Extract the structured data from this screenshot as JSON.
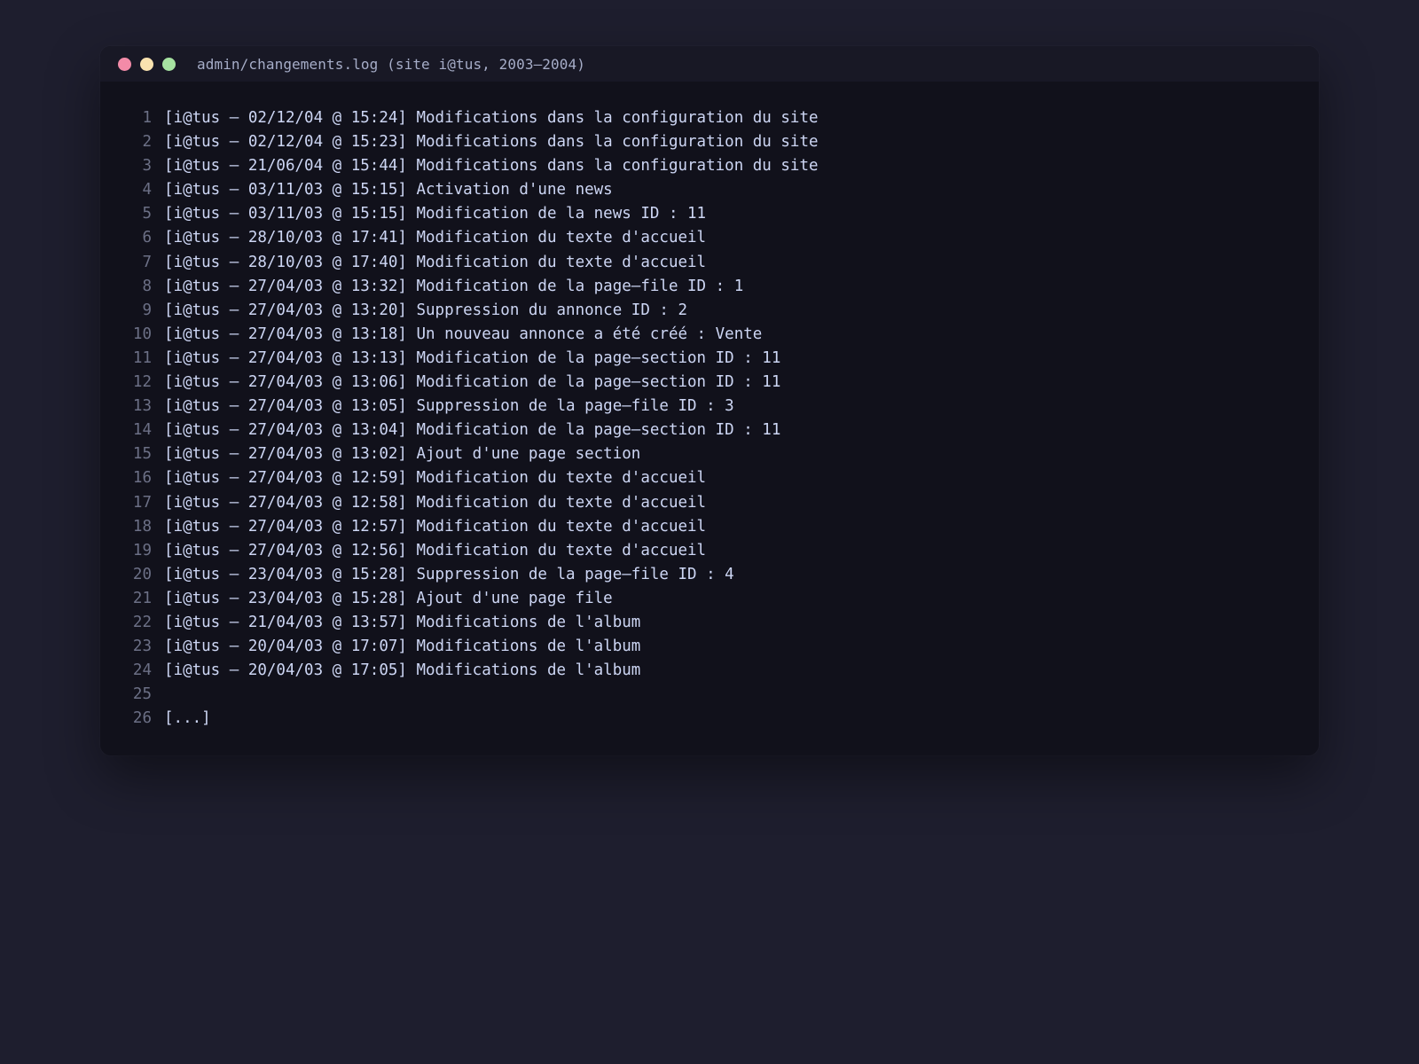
{
  "window": {
    "title": "admin/changements.log (site i@tus, 2003–2004)",
    "controls": [
      "close",
      "minimize",
      "maximize"
    ]
  },
  "log": {
    "lines": [
      {
        "n": "1",
        "text": "[i@tus – 02/12/04 @ 15:24] Modifications dans la configuration du site"
      },
      {
        "n": "2",
        "text": "[i@tus – 02/12/04 @ 15:23] Modifications dans la configuration du site"
      },
      {
        "n": "3",
        "text": "[i@tus – 21/06/04 @ 15:44] Modifications dans la configuration du site"
      },
      {
        "n": "4",
        "text": "[i@tus – 03/11/03 @ 15:15] Activation d'une news"
      },
      {
        "n": "5",
        "text": "[i@tus – 03/11/03 @ 15:15] Modification de la news ID : 11"
      },
      {
        "n": "6",
        "text": "[i@tus – 28/10/03 @ 17:41] Modification du texte d'accueil"
      },
      {
        "n": "7",
        "text": "[i@tus – 28/10/03 @ 17:40] Modification du texte d'accueil"
      },
      {
        "n": "8",
        "text": "[i@tus – 27/04/03 @ 13:32] Modification de la page–file ID : 1"
      },
      {
        "n": "9",
        "text": "[i@tus – 27/04/03 @ 13:20] Suppression du annonce ID : 2"
      },
      {
        "n": "10",
        "text": "[i@tus – 27/04/03 @ 13:18] Un nouveau annonce a été créé : Vente"
      },
      {
        "n": "11",
        "text": "[i@tus – 27/04/03 @ 13:13] Modification de la page–section ID : 11"
      },
      {
        "n": "12",
        "text": "[i@tus – 27/04/03 @ 13:06] Modification de la page–section ID : 11"
      },
      {
        "n": "13",
        "text": "[i@tus – 27/04/03 @ 13:05] Suppression de la page–file ID : 3"
      },
      {
        "n": "14",
        "text": "[i@tus – 27/04/03 @ 13:04] Modification de la page–section ID : 11"
      },
      {
        "n": "15",
        "text": "[i@tus – 27/04/03 @ 13:02] Ajout d'une page section"
      },
      {
        "n": "16",
        "text": "[i@tus – 27/04/03 @ 12:59] Modification du texte d'accueil"
      },
      {
        "n": "17",
        "text": "[i@tus – 27/04/03 @ 12:58] Modification du texte d'accueil"
      },
      {
        "n": "18",
        "text": "[i@tus – 27/04/03 @ 12:57] Modification du texte d'accueil"
      },
      {
        "n": "19",
        "text": "[i@tus – 27/04/03 @ 12:56] Modification du texte d'accueil"
      },
      {
        "n": "20",
        "text": "[i@tus – 23/04/03 @ 15:28] Suppression de la page–file ID : 4"
      },
      {
        "n": "21",
        "text": "[i@tus – 23/04/03 @ 15:28] Ajout d'une page file"
      },
      {
        "n": "22",
        "text": "[i@tus – 21/04/03 @ 13:57] Modifications de l'album"
      },
      {
        "n": "23",
        "text": "[i@tus – 20/04/03 @ 17:07] Modifications de l'album"
      },
      {
        "n": "24",
        "text": "[i@tus – 20/04/03 @ 17:05] Modifications de l'album"
      },
      {
        "n": "25",
        "text": ""
      },
      {
        "n": "26",
        "text": "[...]"
      }
    ]
  },
  "colors": {
    "background": "#1e1e2e",
    "window": "#11111b",
    "titlebar": "#181825",
    "close": "#f38ba8",
    "minimize": "#f9e2af",
    "maximize": "#a6e3a1",
    "text": "#cdd6f4",
    "line_number": "#6c7086"
  }
}
